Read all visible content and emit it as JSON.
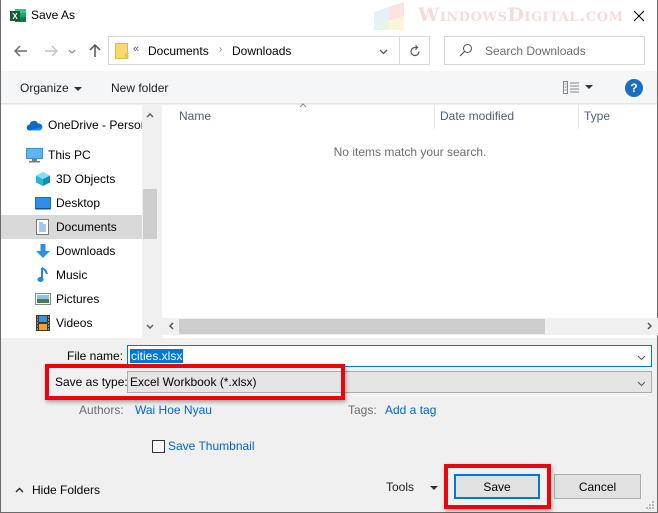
{
  "window": {
    "title": "Save As",
    "app_icon": "excel-icon",
    "watermark": "WindowsDigital.com",
    "close_icon": "close-icon"
  },
  "nav": {
    "back_icon": "arrow-left-icon",
    "forward_icon": "arrow-right-icon",
    "recent_icon": "chevron-down-icon",
    "up_icon": "arrow-up-icon",
    "breadcrumb": {
      "overflow": "«",
      "items": [
        "Documents",
        "Downloads"
      ],
      "separator": "›"
    },
    "refresh_icon": "refresh-icon",
    "search": {
      "placeholder": "Search Downloads",
      "value": ""
    }
  },
  "toolbar": {
    "organize_label": "Organize",
    "new_folder_label": "New folder",
    "views_icon": "details-view-icon",
    "help_icon": "help-icon",
    "help_glyph": "?"
  },
  "navpane": {
    "items": [
      {
        "label": "OneDrive - Persor",
        "icon": "onedrive-icon",
        "selected": false
      },
      {
        "label": "This PC",
        "icon": "computer-icon",
        "selected": false
      },
      {
        "label": "3D Objects",
        "icon": "3d-objects-icon",
        "selected": false
      },
      {
        "label": "Desktop",
        "icon": "desktop-icon",
        "selected": false
      },
      {
        "label": "Documents",
        "icon": "documents-icon",
        "selected": true
      },
      {
        "label": "Downloads",
        "icon": "downloads-icon",
        "selected": false
      },
      {
        "label": "Music",
        "icon": "music-icon",
        "selected": false
      },
      {
        "label": "Pictures",
        "icon": "pictures-icon",
        "selected": false
      },
      {
        "label": "Videos",
        "icon": "videos-icon",
        "selected": false
      }
    ]
  },
  "filelist": {
    "columns": [
      "Name",
      "Date modified",
      "Type"
    ],
    "sorted_by": "Name",
    "empty_message": "No items match your search."
  },
  "form": {
    "file_name_label": "File name:",
    "file_name_value": "cities.xlsx",
    "save_type_label": "Save as type:",
    "save_type_value": "Excel Workbook (*.xlsx)",
    "authors_label": "Authors:",
    "authors_value": "Wai Hoe Nyau",
    "tags_label": "Tags:",
    "tags_value": "Add a tag",
    "save_thumbnail_label": "Save Thumbnail",
    "save_thumbnail_checked": false
  },
  "footer": {
    "hide_folders_label": "Hide Folders",
    "tools_label": "Tools",
    "save_label": "Save",
    "cancel_label": "Cancel"
  },
  "annotations": {
    "highlight_color": "#e8060e",
    "highlighted": [
      "save-as-type",
      "save-button"
    ]
  },
  "colors": {
    "accent": "#0078d7",
    "link": "#0066cc",
    "help_blue": "#1a6fc2",
    "excel_green": "#1d6f42"
  }
}
